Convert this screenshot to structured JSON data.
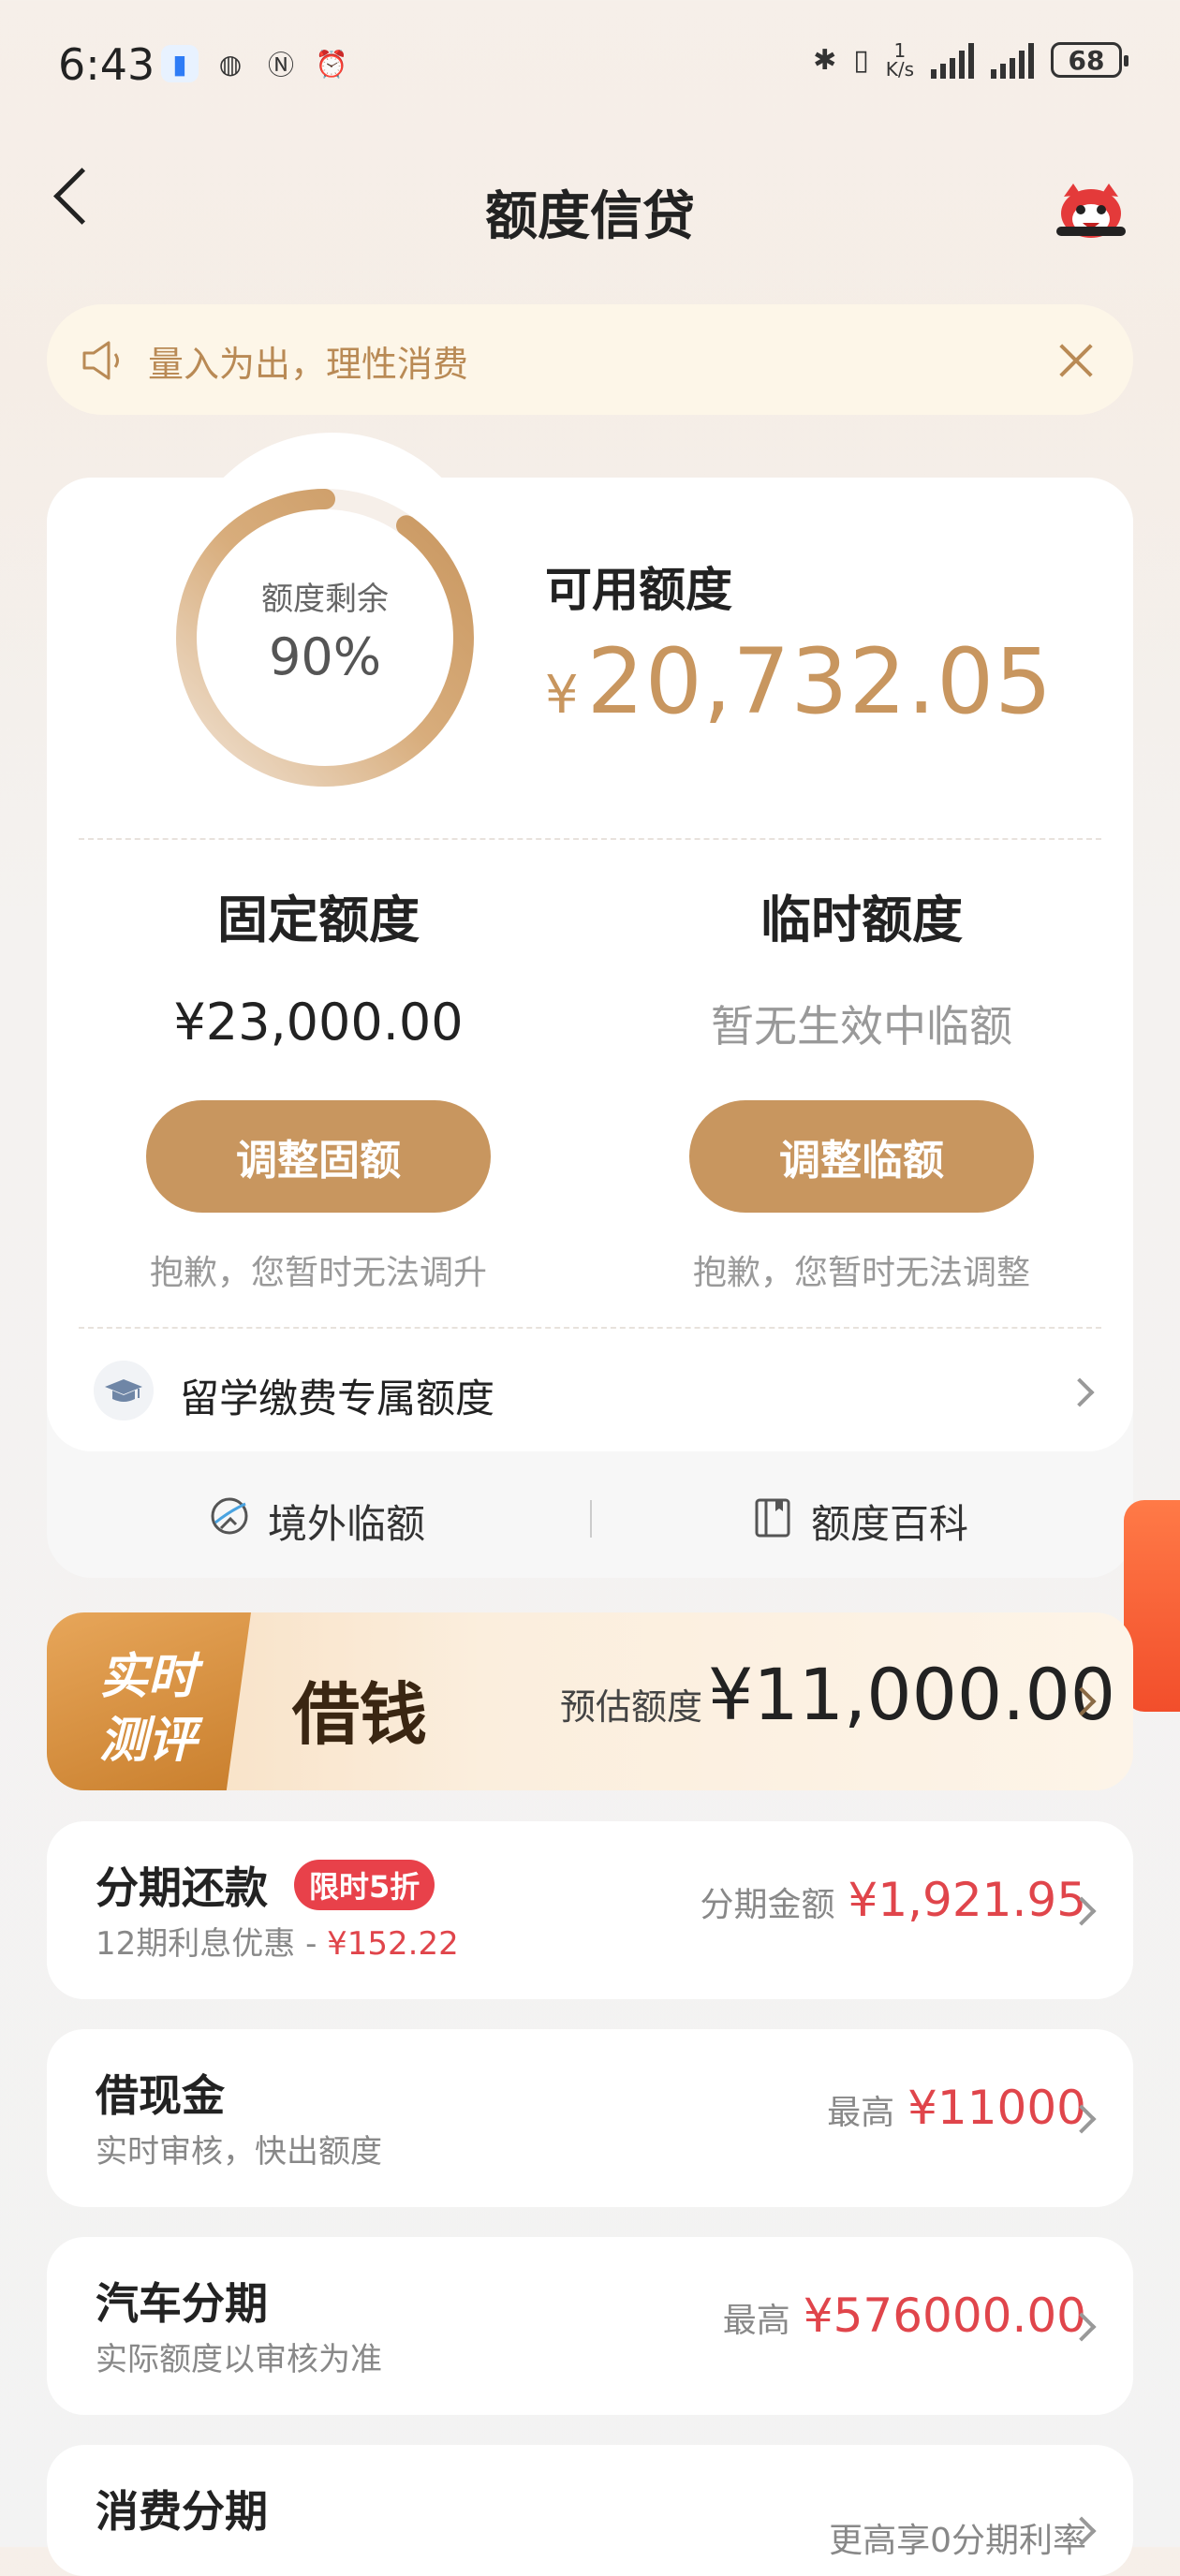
{
  "status_bar": {
    "time": "6:43",
    "net_speed": "1",
    "net_unit": "K/s",
    "battery": "68"
  },
  "header": {
    "title": "额度信贷"
  },
  "notice": {
    "text": "量入为出，理性消费"
  },
  "quota": {
    "ring_label": "额度剩余",
    "ring_value": "90%",
    "ring_fraction": 0.9,
    "available_label": "可用额度",
    "available_currency": "¥",
    "available_amount": "20,732.05",
    "fixed": {
      "title": "固定额度",
      "amount": "¥23,000.00",
      "button": "调整固额",
      "note": "抱歉，您暂时无法调升"
    },
    "temporary": {
      "title": "临时额度",
      "status": "暂无生效中临额",
      "button": "调整临额",
      "note": "抱歉，您暂时无法调整"
    },
    "study_abroad": "留学缴费专属额度",
    "tools": {
      "overseas": "境外临额",
      "wiki": "额度百科"
    }
  },
  "borrow_banner": {
    "badge_line1": "实时",
    "badge_line2": "测评",
    "title": "借钱",
    "estimate_label": "预估额度",
    "estimate_amount": "¥11,000.00"
  },
  "cards": [
    {
      "title": "分期还款",
      "tag": "限时5折",
      "sub_prefix": "12期利息优惠 - ",
      "sub_value": "¥152.22",
      "right_label": "分期金额",
      "right_value": "¥1,921.95"
    },
    {
      "title": "借现金",
      "sub": "实时审核，快出额度",
      "right_label": "最高",
      "right_value": "¥11000"
    },
    {
      "title": "汽车分期",
      "sub": "实际额度以审核为准",
      "right_label": "最高",
      "right_value": "¥576000.00"
    },
    {
      "title": "消费分期",
      "right_label": "更高享0分期利率"
    }
  ],
  "colors": {
    "accent_gold": "#c8965f",
    "price_red": "#e0454b",
    "notice_bg": "#fdf6e8"
  }
}
